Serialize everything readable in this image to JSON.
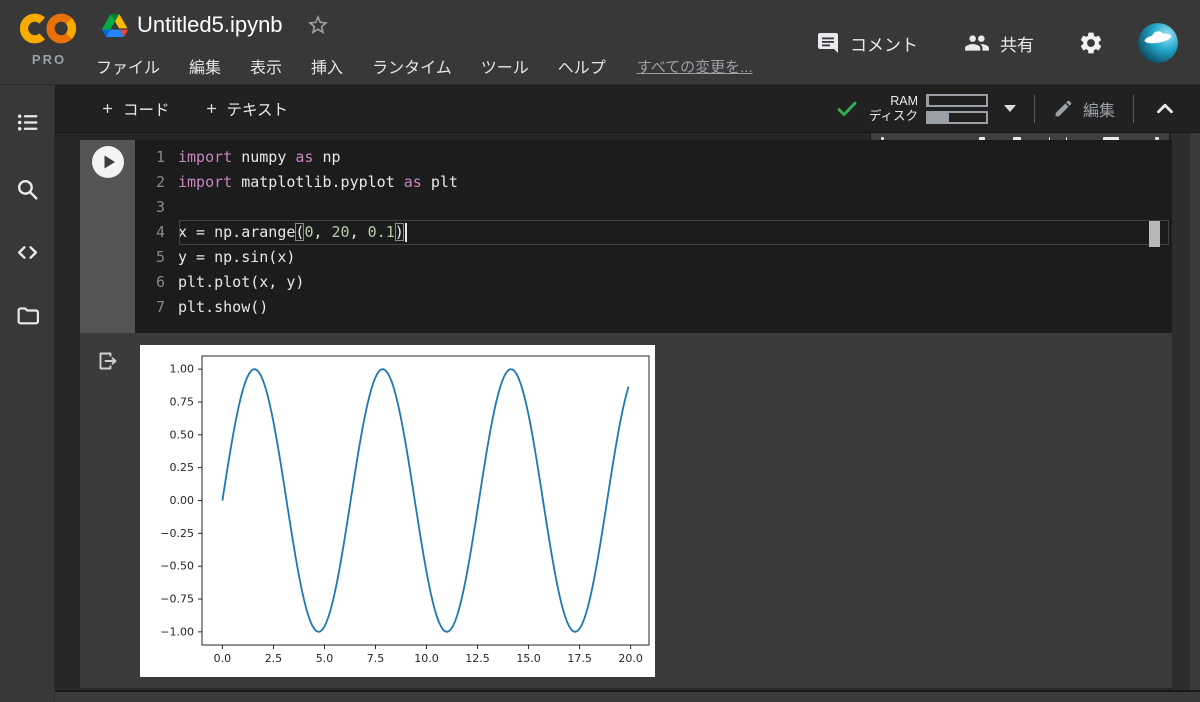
{
  "header": {
    "pro_label": "PRO",
    "title": "Untitled5.ipynb",
    "menus": [
      {
        "id": "file",
        "label": "ファイル"
      },
      {
        "id": "edit",
        "label": "編集"
      },
      {
        "id": "view",
        "label": "表示"
      },
      {
        "id": "insert",
        "label": "挿入"
      },
      {
        "id": "runtime",
        "label": "ランタイム"
      },
      {
        "id": "tools",
        "label": "ツール"
      },
      {
        "id": "help",
        "label": "ヘルプ"
      }
    ],
    "changes_link": "すべての変更を...",
    "comment_label": "コメント",
    "share_label": "共有"
  },
  "toolbar": {
    "add_code_label": "コード",
    "add_text_label": "テキスト",
    "ram_label": "RAM",
    "disk_label": "ディスク",
    "edit_label": "編集",
    "status": {
      "ram_used_pct": 2,
      "disk_used_pct": 36
    }
  },
  "sidebar_icons": [
    "table-of-contents",
    "search",
    "code-snippets",
    "files"
  ],
  "icons": {
    "logo": "colab-rings",
    "file": "google-drive-triangle",
    "favorite": "star-outline",
    "comment": "speech-bubble",
    "share": "two-people",
    "settings": "gear",
    "connected": "green-checkmark",
    "expand": "caret-down",
    "edit": "pencil",
    "collapse": "chevron-up",
    "run": "play-circle",
    "output": "export-arrow"
  },
  "code_cell": {
    "lines": [
      {
        "num": "1",
        "tokens": [
          {
            "t": "import",
            "c": "kw"
          },
          {
            "t": " numpy ",
            "c": "pl"
          },
          {
            "t": "as",
            "c": "kw"
          },
          {
            "t": " np",
            "c": "pl"
          }
        ]
      },
      {
        "num": "2",
        "tokens": [
          {
            "t": "import",
            "c": "kw"
          },
          {
            "t": " matplotlib.pyplot ",
            "c": "pl"
          },
          {
            "t": "as",
            "c": "kw"
          },
          {
            "t": " plt",
            "c": "pl"
          }
        ]
      },
      {
        "num": "3",
        "tokens": []
      },
      {
        "num": "4",
        "current": true,
        "tokens": [
          {
            "t": "x = np.arange",
            "c": "pl"
          },
          {
            "t": "(",
            "c": "bracket"
          },
          {
            "t": "0",
            "c": "num"
          },
          {
            "t": ", ",
            "c": "pl"
          },
          {
            "t": "20",
            "c": "num"
          },
          {
            "t": ", ",
            "c": "pl"
          },
          {
            "t": "0.1",
            "c": "num"
          },
          {
            "t": ")",
            "c": "bracket"
          },
          {
            "t": "",
            "c": "cursor"
          }
        ]
      },
      {
        "num": "5",
        "tokens": [
          {
            "t": "y = np.sin(x)",
            "c": "pl"
          }
        ]
      },
      {
        "num": "6",
        "tokens": [
          {
            "t": "plt.plot(x, y)",
            "c": "pl"
          }
        ]
      },
      {
        "num": "7",
        "tokens": [
          {
            "t": "plt.show()",
            "c": "pl"
          }
        ]
      }
    ]
  },
  "chart_data": {
    "type": "line",
    "title": "",
    "xlabel": "",
    "ylabel": "",
    "series": [
      {
        "name": "sin(x)",
        "fn": "sin",
        "x_start": 0,
        "x_end": 19.9,
        "step": 0.1,
        "amplitude": 1,
        "color": "#1f77b4"
      }
    ],
    "xlim": [
      -1.0,
      20.9
    ],
    "ylim": [
      -1.1,
      1.1
    ],
    "xticks": [
      0,
      2.5,
      5,
      7.5,
      10,
      12.5,
      15,
      17.5,
      20
    ],
    "xtick_labels": [
      "0.0",
      "2.5",
      "5.0",
      "7.5",
      "10.0",
      "12.5",
      "15.0",
      "17.5",
      "20.0"
    ],
    "yticks": [
      1,
      0.75,
      0.5,
      0.25,
      0,
      -0.25,
      -0.5,
      -0.75,
      -1
    ],
    "ytick_labels": [
      "1.00",
      "0.75",
      "0.50",
      "0.25",
      "0.00",
      "−0.25",
      "−0.50",
      "−0.75",
      "−1.00"
    ],
    "grid": false,
    "legend": "none"
  }
}
